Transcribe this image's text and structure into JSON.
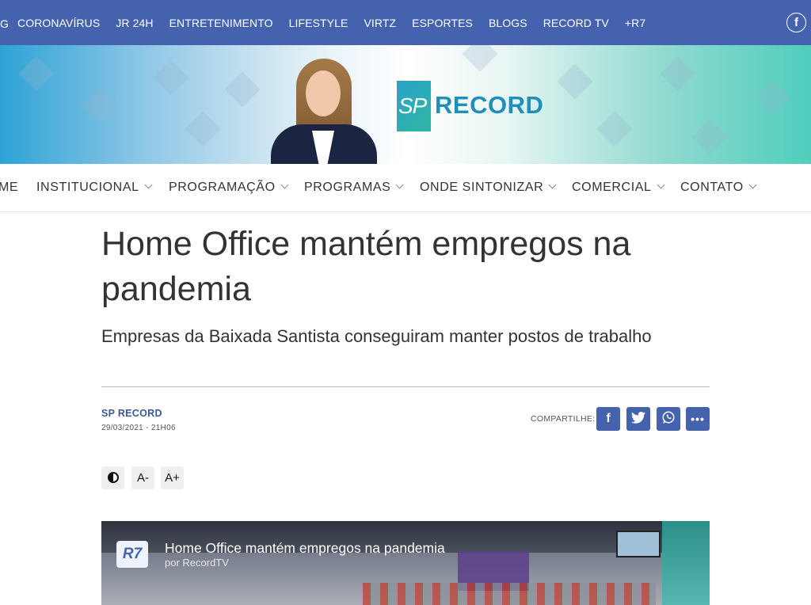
{
  "topbar": {
    "edge_text": "G",
    "items": [
      "CORONAVÍRUS",
      "JR 24H",
      "ENTRETENIMENTO",
      "LIFESTYLE",
      "VIRTZ",
      "ESPORTES",
      "BLOGS",
      "RECORD TV",
      "+R7"
    ],
    "social": "f"
  },
  "banner": {
    "logo_sp": "SP",
    "logo_record": "RECORD"
  },
  "sitenav": {
    "items": [
      "ME",
      "INSTITUCIONAL",
      "PROGRAMAÇÃO",
      "PROGRAMAS",
      "ONDE SINTONIZAR",
      "COMERCIAL",
      "CONTATO"
    ]
  },
  "article": {
    "title": "Home Office mantém empregos na pandemia",
    "subtitle": "Empresas da Baixada Santista conseguiram manter postos de trabalho",
    "source": "SP RECORD",
    "date": "29/03/2021 - 21H06",
    "share_label": "COMPARTILHE:",
    "share_icons": [
      "facebook-icon",
      "twitter-icon",
      "whatsapp-icon",
      "more-icon"
    ],
    "accessibility": {
      "decrease": "A-",
      "increase": "A+"
    }
  },
  "video": {
    "logo": "R7",
    "title": "Home Office mantém empregos na pandemia",
    "byline": "por RecordTV"
  },
  "colors": {
    "brand_blue": "#4462ae",
    "text": "#333333",
    "link_blue": "#3b5998"
  }
}
